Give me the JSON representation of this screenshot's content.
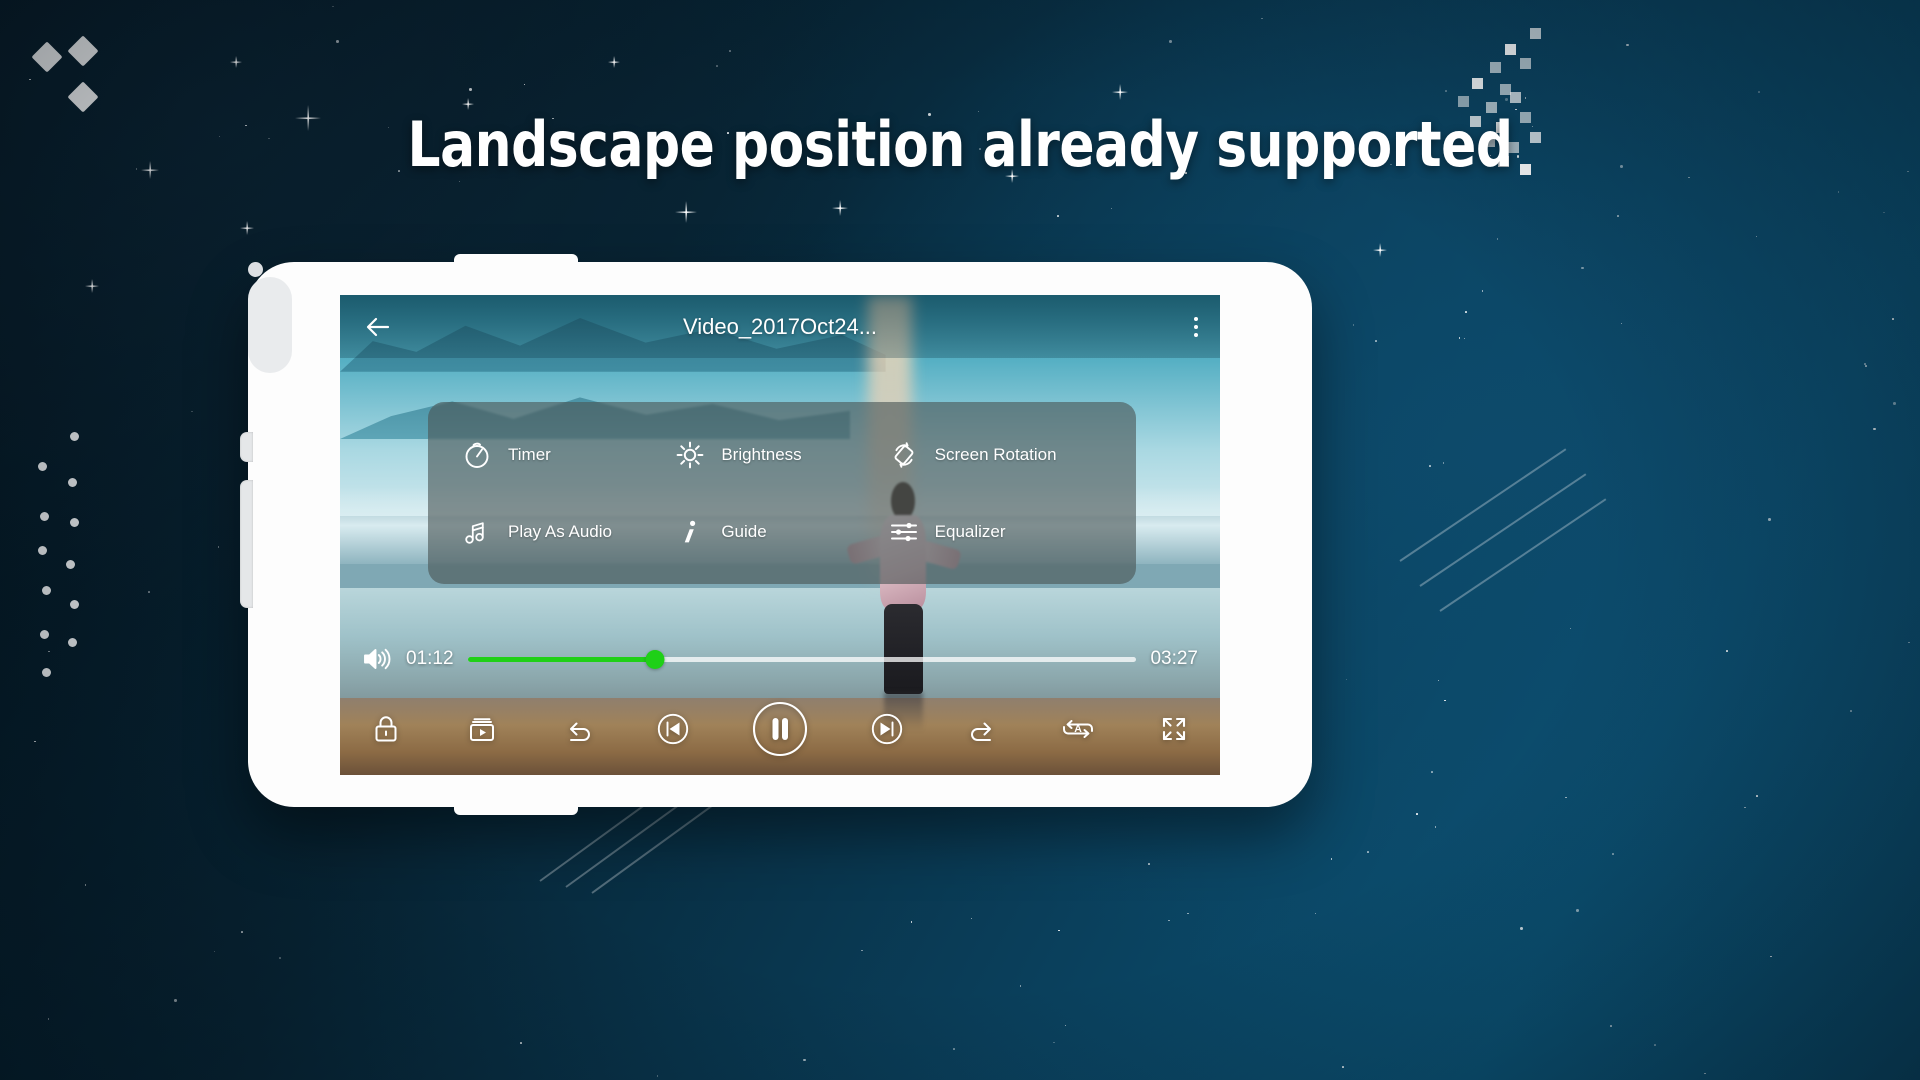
{
  "headline": "Landscape position already supported",
  "colors": {
    "accent_green": "#1FD017",
    "panel_overlay": "rgba(74,86,86,0.62)",
    "phone_body": "#fdfdfd",
    "text_white": "#ffffff",
    "bg_deep_navy": "#04131d",
    "bg_teal": "#0b5173"
  },
  "player": {
    "topbar": {
      "back_icon": "back-arrow-icon",
      "title": "Video_2017Oct24...",
      "overflow_icon": "kebab-menu-icon"
    },
    "menu": {
      "items": [
        {
          "label": "Timer",
          "icon": "timer-icon"
        },
        {
          "label": "Brightness",
          "icon": "brightness-sun-icon"
        },
        {
          "label": "Screen Rotation",
          "icon": "screen-rotation-icon"
        },
        {
          "label": "Play As Audio",
          "icon": "music-note-icon"
        },
        {
          "label": "Guide",
          "icon": "info-italic-icon"
        },
        {
          "label": "Equalizer",
          "icon": "equalizer-sliders-icon"
        }
      ]
    },
    "seek": {
      "volume_icon": "volume-speaker-icon",
      "current_time": "01:12",
      "total_time": "03:27",
      "progress_percent": 28
    },
    "controls": [
      {
        "name": "lock-button",
        "icon": "lock-icon"
      },
      {
        "name": "playlist-button",
        "icon": "video-playlist-icon"
      },
      {
        "name": "rewind-button",
        "icon": "rewind-undo-arrow-icon"
      },
      {
        "name": "previous-track-button",
        "icon": "previous-track-icon"
      },
      {
        "name": "play-pause-button",
        "icon": "pause-icon"
      },
      {
        "name": "next-track-button",
        "icon": "next-track-icon"
      },
      {
        "name": "forward-button",
        "icon": "forward-redo-arrow-icon"
      },
      {
        "name": "repeat-button",
        "icon": "repeat-all-a-icon"
      },
      {
        "name": "fullscreen-button",
        "icon": "fullscreen-expand-icon"
      }
    ]
  }
}
